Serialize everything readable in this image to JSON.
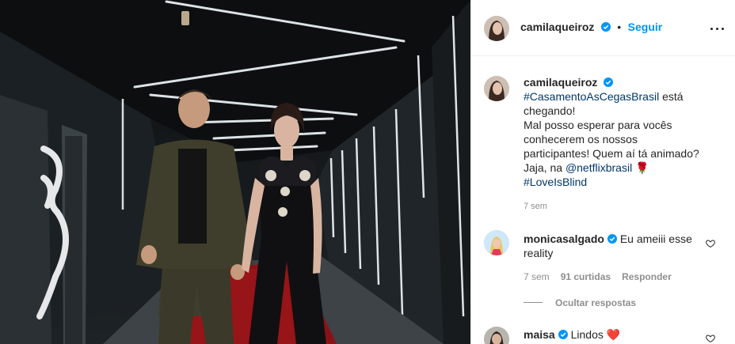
{
  "post": {
    "author": "camilaqueiroz",
    "follow_label": "Seguir",
    "separator": "•",
    "caption": {
      "author": "camilaqueiroz",
      "hashtag1": "#CasamentoAsCegasBrasil",
      "line1_rest": " está",
      "line2": "chegando!",
      "line3": "Mal posso esperar para vocês",
      "line4": "conhecerem os nossos",
      "line5": "participantes! Quem aí tá animado?",
      "line6_pre": "Jaja, na ",
      "mention": "@netflixbrasil",
      "emoji_rose": "🌹",
      "hashtag2": "#LoveIsBlind",
      "time": "7 sem"
    }
  },
  "comments": [
    {
      "author": "monicasalgado",
      "text_line1": "Eu ameiii esse",
      "text_line2": "reality",
      "time": "7 sem",
      "likes": "91 curtidas",
      "reply_label": "Responder",
      "hide_replies": "Ocultar respostas"
    },
    {
      "author": "maisa",
      "text": "Lindos",
      "emoji": "❤️"
    }
  ],
  "colors": {
    "link": "#00376b",
    "follow": "#0095f6",
    "verified": "#0095f6",
    "muted": "#8e8e8e",
    "carpet": "#8a1216"
  }
}
